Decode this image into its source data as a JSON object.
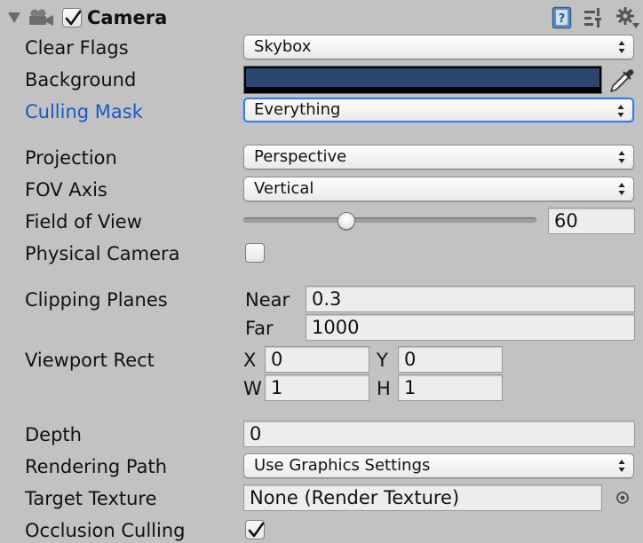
{
  "component": {
    "title": "Camera",
    "enabled": true,
    "icons": [
      "foldout-arrow-icon",
      "camera-icon",
      "help-book-icon",
      "preset-sliders-icon",
      "settings-gear-icon"
    ]
  },
  "fields": {
    "clear_flags": {
      "label": "Clear Flags",
      "value": "Skybox"
    },
    "background": {
      "label": "Background",
      "color": "#2b4770"
    },
    "culling_mask": {
      "label": "Culling Mask",
      "value": "Everything"
    },
    "projection": {
      "label": "Projection",
      "value": "Perspective"
    },
    "fov_axis": {
      "label": "FOV Axis",
      "value": "Vertical"
    },
    "field_of_view": {
      "label": "Field of View",
      "value": "60",
      "slider_fraction": 0.35
    },
    "physical_camera": {
      "label": "Physical Camera",
      "checked": false
    },
    "clipping_planes": {
      "label": "Clipping Planes",
      "near_label": "Near",
      "near": "0.3",
      "far_label": "Far",
      "far": "1000"
    },
    "viewport_rect": {
      "label": "Viewport Rect",
      "x_label": "X",
      "x": "0",
      "y_label": "Y",
      "y": "0",
      "w_label": "W",
      "w": "1",
      "h_label": "H",
      "h": "1"
    },
    "depth": {
      "label": "Depth",
      "value": "0"
    },
    "rendering_path": {
      "label": "Rendering Path",
      "value": "Use Graphics Settings"
    },
    "target_texture": {
      "label": "Target Texture",
      "value": "None (Render Texture)"
    },
    "occlusion_culling": {
      "label": "Occlusion Culling",
      "checked": true
    }
  },
  "colors": {
    "accent_label": "#1d56c6",
    "focus_ring": "#3a7ad8",
    "background_panel": "#c2c2c2"
  }
}
